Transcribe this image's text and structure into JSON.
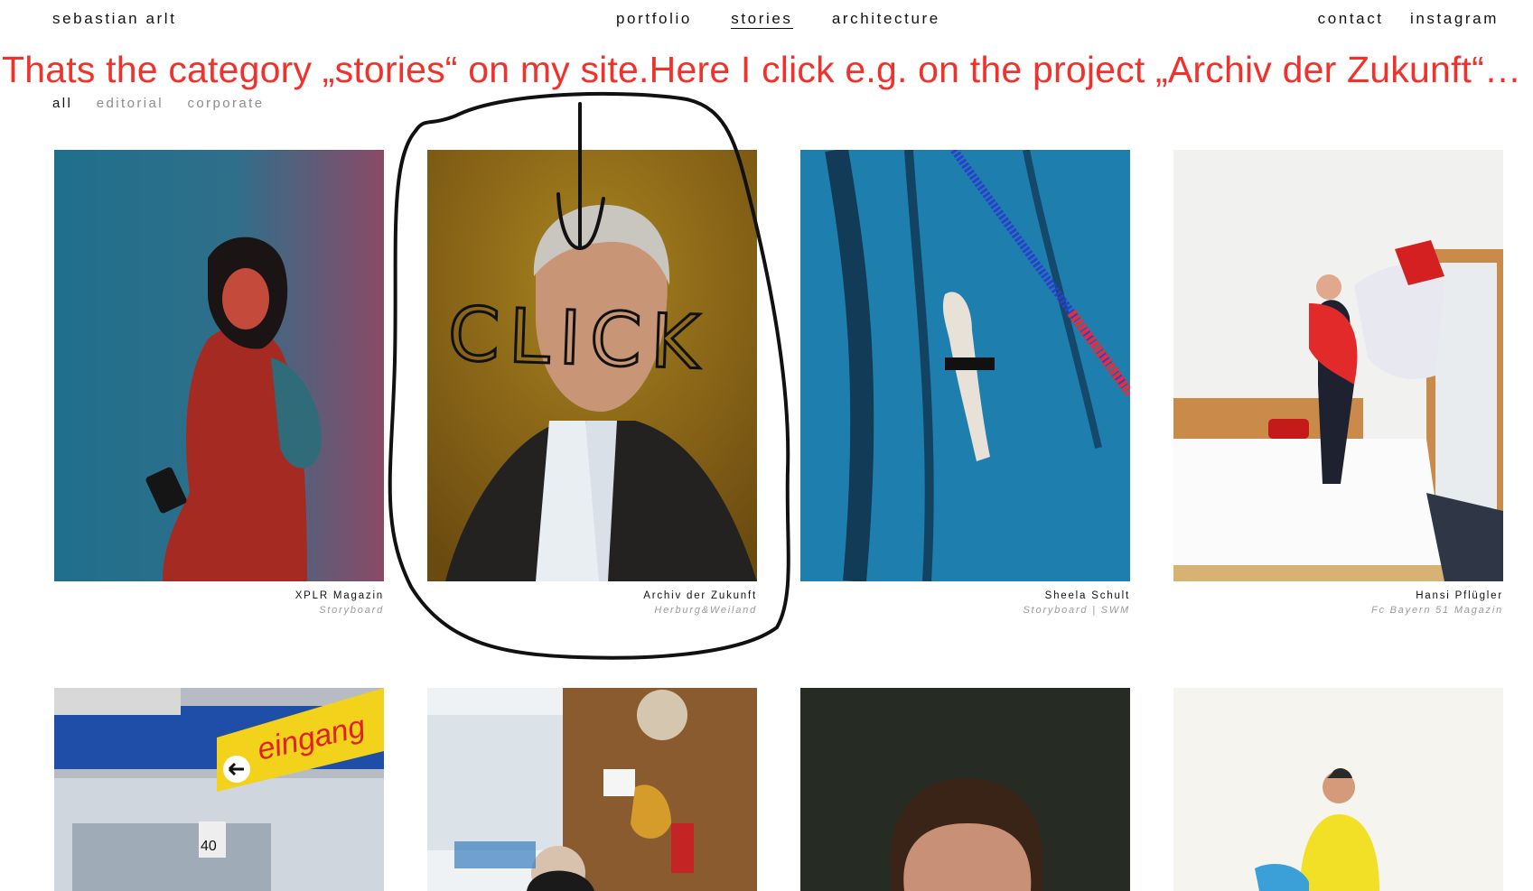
{
  "header": {
    "brand": "sebastian arlt",
    "nav": [
      "portfolio",
      "stories",
      "architecture"
    ],
    "right": [
      "contact",
      "instagram"
    ]
  },
  "annotation": {
    "text": "Thats the category „stories“ on my site.Here I click e.g. on the project „Archiv der Zukunft“…",
    "handwriting": "CLICK",
    "color": "#f0322d"
  },
  "filters": [
    "all",
    "editorial",
    "corporate"
  ],
  "projects": [
    {
      "title": "XPLR Magazin",
      "subtitle": "Storyboard"
    },
    {
      "title": "Archiv der Zukunft",
      "subtitle": "Herburg&Weiland"
    },
    {
      "title": "Sheela Schult",
      "subtitle": "Storyboard | SWM"
    },
    {
      "title": "Hansi Pflügler",
      "subtitle": "Fc Bayern 51 Magazin"
    }
  ],
  "second_row": {
    "sign_text": "eingang",
    "price_tag": "40"
  }
}
